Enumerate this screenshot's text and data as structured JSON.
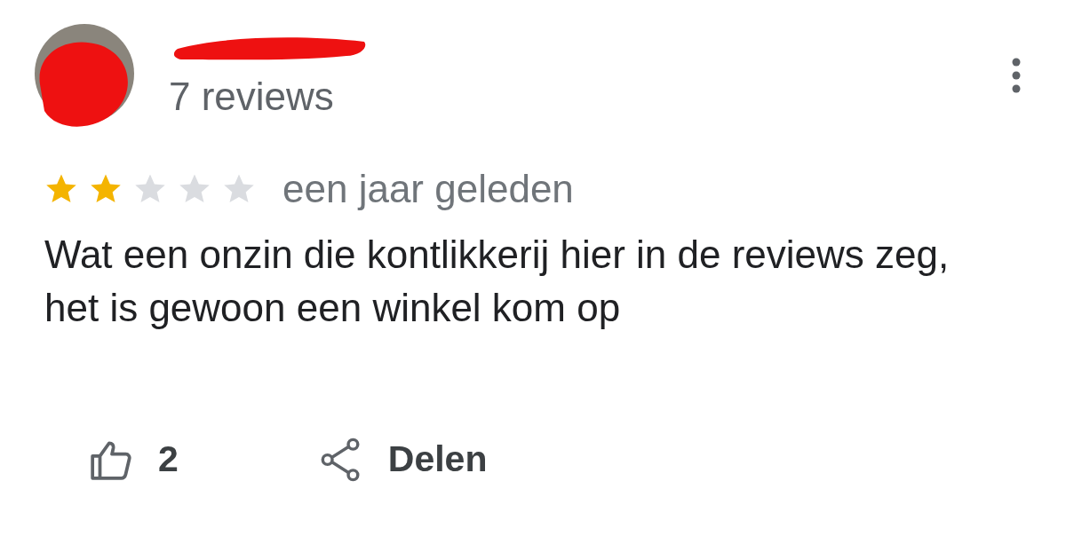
{
  "reviewer": {
    "review_count": "7 reviews"
  },
  "rating": {
    "stars": 2,
    "time": "een jaar geleden"
  },
  "text": "Wat een onzin die kontlikkerij hier in de reviews zeg, het is gewoon een winkel kom op",
  "actions": {
    "likes": "2",
    "share": "Delen"
  }
}
